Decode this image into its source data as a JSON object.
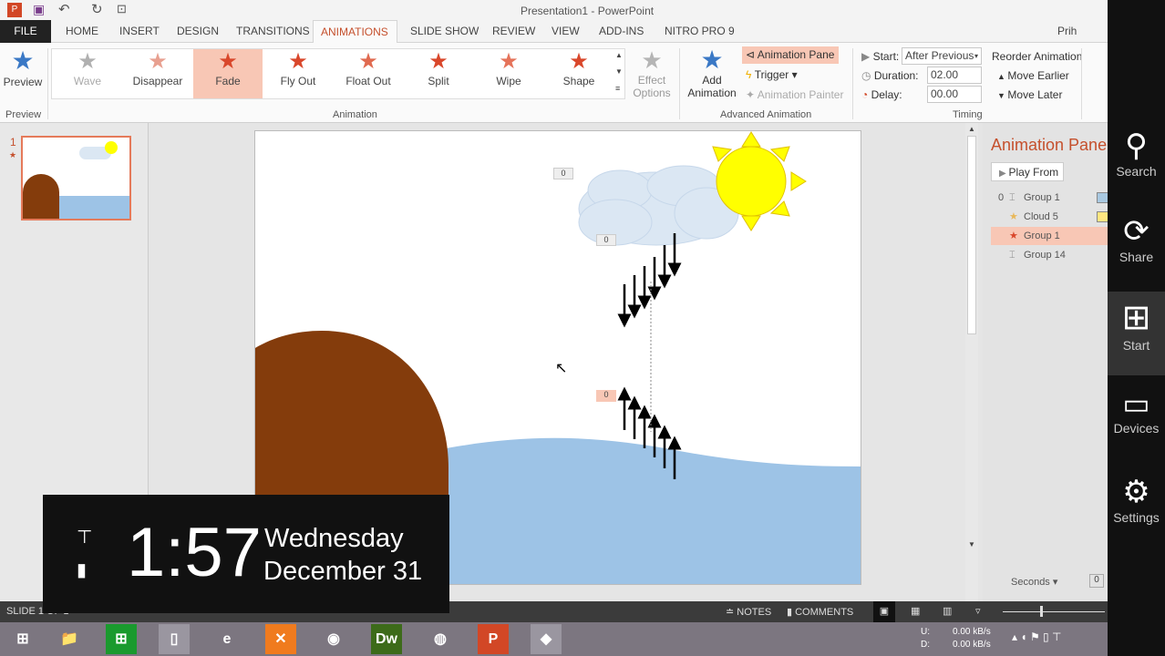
{
  "app": {
    "title": "Presentation1 - PowerPoint",
    "user": "Prih Hatmo"
  },
  "tabs": [
    "FILE",
    "HOME",
    "INSERT",
    "DESIGN",
    "TRANSITIONS",
    "ANIMATIONS",
    "SLIDE SHOW",
    "REVIEW",
    "VIEW",
    "ADD-INS",
    "NITRO PRO 9"
  ],
  "active_tab": "ANIMATIONS",
  "ribbon": {
    "preview": {
      "label": "Preview",
      "group": "Preview"
    },
    "animations": [
      {
        "label": "Wave",
        "color": "#b0b0b0"
      },
      {
        "label": "Disappear",
        "color": "#e8a090"
      },
      {
        "label": "Fade",
        "color": "#d9472b"
      },
      {
        "label": "Fly Out",
        "color": "#d9472b"
      },
      {
        "label": "Float Out",
        "color": "#e06a50"
      },
      {
        "label": "Split",
        "color": "#d9472b"
      },
      {
        "label": "Wipe",
        "color": "#e5735a"
      },
      {
        "label": "Shape",
        "color": "#d9472b"
      }
    ],
    "selected_animation": "Fade",
    "animation_group": "Animation",
    "effect_options": {
      "line1": "Effect",
      "line2": "Options"
    },
    "add_animation": {
      "line1": "Add",
      "line2": "Animation"
    },
    "animation_pane": "Animation Pane",
    "trigger": "Trigger",
    "animation_painter": "Animation Painter",
    "advanced_group": "Advanced Animation",
    "start_label": "Start:",
    "start_value": "After Previous",
    "duration_label": "Duration:",
    "duration_value": "02.00",
    "delay_label": "Delay:",
    "delay_value": "00.00",
    "timing_group": "Timing",
    "reorder": "Reorder Animation",
    "move_earlier": "Move Earlier",
    "move_later": "Move Later"
  },
  "thumbs": {
    "number": "1",
    "star": "★"
  },
  "slide": {
    "tags": [
      "0",
      "0",
      "0"
    ],
    "colors": {
      "hill": "#843c0c",
      "water": "#9dc3e6",
      "sun": "#ffff00",
      "cloud": "#dbe7f3"
    }
  },
  "pane": {
    "title": "Animation Pane",
    "play_from": "Play From",
    "items": [
      {
        "index": "0",
        "name": "Group 1",
        "icon": "line-path",
        "bar": "#a8c8e0"
      },
      {
        "index": "",
        "name": "Cloud 5",
        "icon": "star-gold",
        "bar": "#ffe680"
      },
      {
        "index": "",
        "name": "Group 1",
        "icon": "star-red",
        "selected": true
      },
      {
        "index": "",
        "name": "Group 14",
        "icon": "line-path"
      }
    ],
    "seconds": "Seconds",
    "zoom_value": "0"
  },
  "charms": [
    "Search",
    "Share",
    "Start",
    "Devices",
    "Settings"
  ],
  "status": {
    "slide": "SLIDE 1 OF 1",
    "notes": "NOTES",
    "comments": "COMMENTS"
  },
  "clock": {
    "time": "1:57",
    "day": "Wednesday",
    "date": "December 31"
  },
  "tray": {
    "up_label": "U:",
    "up": "0.00 kB/s",
    "down_label": "D:",
    "down": "0.00 kB/s"
  },
  "taskbar": [
    {
      "name": "windows-start",
      "glyph": "⊞",
      "bg": ""
    },
    {
      "name": "file-explorer",
      "glyph": "📁",
      "bg": ""
    },
    {
      "name": "store",
      "glyph": "⊞",
      "bg": "#1a9a2e"
    },
    {
      "name": "app",
      "glyph": "▯",
      "bg": "#9a96a0"
    },
    {
      "name": "internet-explorer",
      "glyph": "e",
      "bg": ""
    },
    {
      "name": "xampp",
      "glyph": "✕",
      "bg": "#f07b1e"
    },
    {
      "name": "chrome",
      "glyph": "◉",
      "bg": ""
    },
    {
      "name": "dreamweaver",
      "glyph": "Dw",
      "bg": "#3d6b1a"
    },
    {
      "name": "google-earth",
      "glyph": "◍",
      "bg": ""
    },
    {
      "name": "powerpoint",
      "glyph": "P",
      "bg": "#d24726"
    },
    {
      "name": "recorder",
      "glyph": "◆",
      "bg": "#9a96a0"
    }
  ]
}
